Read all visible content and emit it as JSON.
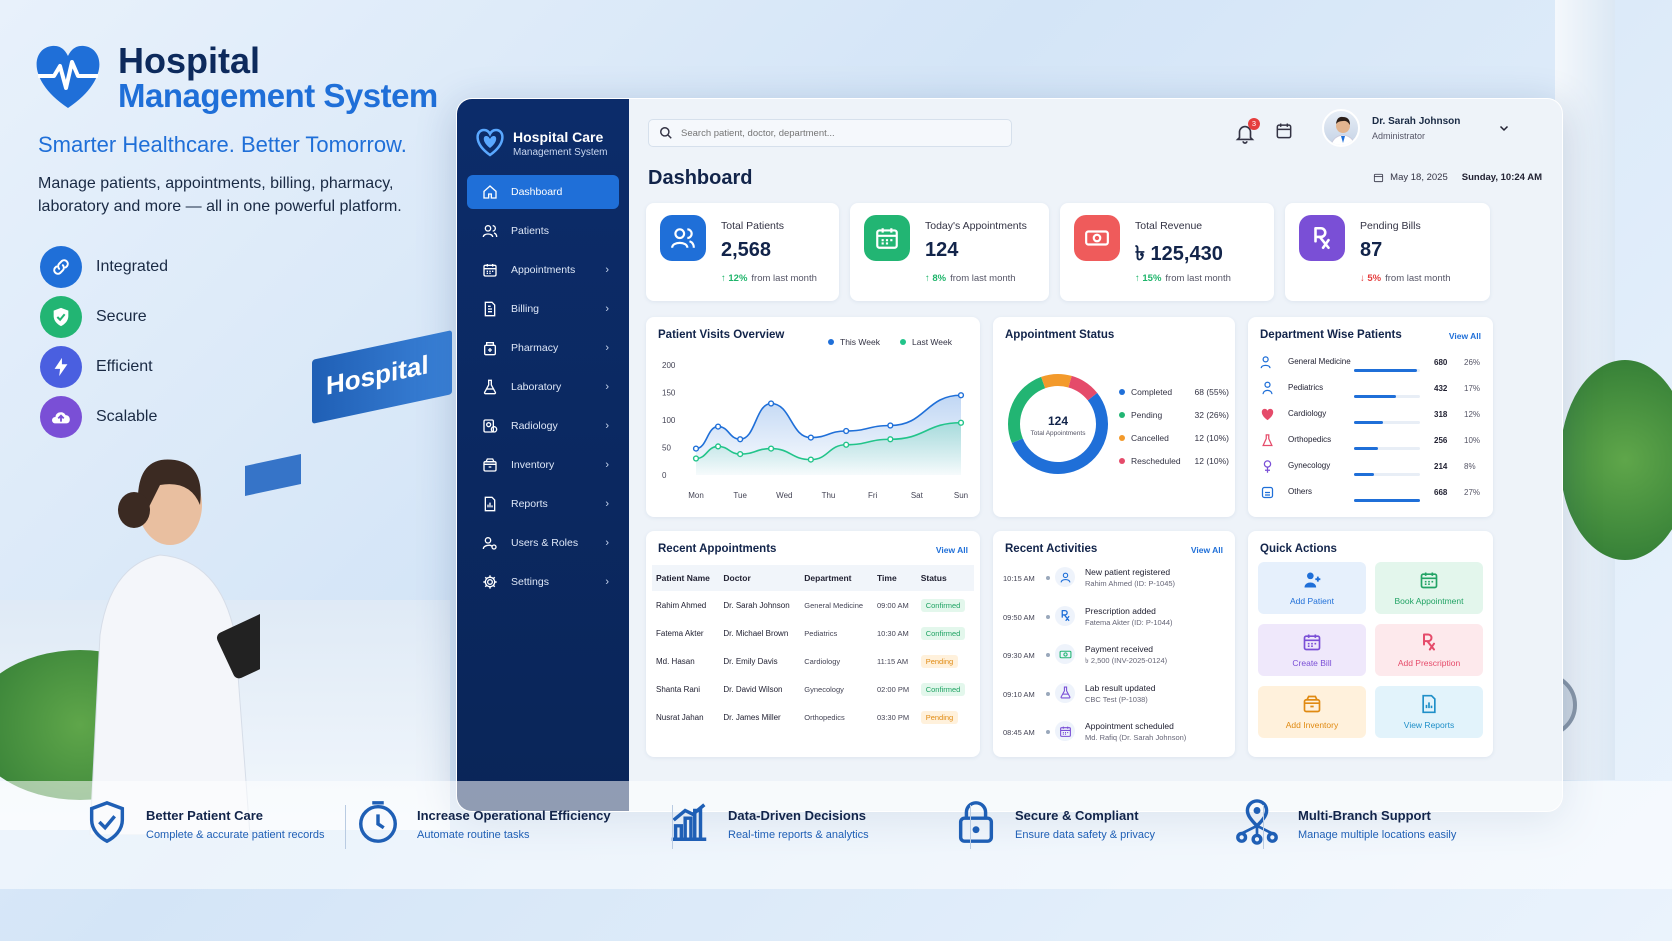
{
  "brand": {
    "title_line1": "Hospital",
    "title_line2": "Management System",
    "tagline": "Smarter Healthcare. Better Tomorrow.",
    "intro": "Manage patients, appointments, billing, pharmacy, laboratory and more — all in one powerful platform."
  },
  "background": {
    "sign_text": "Hospital"
  },
  "features": [
    {
      "label": "Integrated",
      "icon": "link-icon",
      "color": "#1f6fd8"
    },
    {
      "label": "Secure",
      "icon": "shield-check-icon",
      "color": "#22b573"
    },
    {
      "label": "Efficient",
      "icon": "lightning-icon",
      "color": "#4a5fe0"
    },
    {
      "label": "Scalable",
      "icon": "cloud-upload-icon",
      "color": "#7a4fd6"
    }
  ],
  "app": {
    "sidebar_brand": {
      "title": "Hospital Care",
      "subtitle": "Management System"
    },
    "menu": [
      {
        "label": "Dashboard",
        "icon": "home-icon",
        "active": true,
        "chevron": false
      },
      {
        "label": "Patients",
        "icon": "users-icon",
        "chevron": false
      },
      {
        "label": "Appointments",
        "icon": "calendar-icon",
        "chevron": true
      },
      {
        "label": "Billing",
        "icon": "invoice-icon",
        "chevron": true
      },
      {
        "label": "Pharmacy",
        "icon": "pharmacy-icon",
        "chevron": true
      },
      {
        "label": "Laboratory",
        "icon": "flask-icon",
        "chevron": true
      },
      {
        "label": "Radiology",
        "icon": "radiology-icon",
        "chevron": true
      },
      {
        "label": "Inventory",
        "icon": "box-icon",
        "chevron": true
      },
      {
        "label": "Reports",
        "icon": "report-icon",
        "chevron": true
      },
      {
        "label": "Users & Roles",
        "icon": "user-roles-icon",
        "chevron": true
      },
      {
        "label": "Settings",
        "icon": "gear-icon",
        "chevron": true
      }
    ],
    "search_placeholder": "Search patient, doctor, department...",
    "notification_count": "3",
    "user": {
      "name": "Dr. Sarah Johnson",
      "role": "Administrator"
    },
    "page_title": "Dashboard",
    "date": "May 18, 2025",
    "day_time": "Sunday, 10:24 AM",
    "stats": [
      {
        "label": "Total Patients",
        "value": "2,568",
        "change": "↑ 12%",
        "change_text": "from last month",
        "trend": "up",
        "icon": "patients-icon",
        "color": "#1f6fd8"
      },
      {
        "label": "Today's Appointments",
        "value": "124",
        "change": "↑ 8%",
        "change_text": "from last month",
        "trend": "up",
        "icon": "calendar-icon",
        "color": "#22b573"
      },
      {
        "label": "Total Revenue",
        "value": "৳ 125,430",
        "change": "↑ 15%",
        "change_text": "from last month",
        "trend": "up",
        "icon": "cash-icon",
        "color": "#ef5b5b"
      },
      {
        "label": "Pending Bills",
        "value": "87",
        "change": "↓ 5%",
        "change_text": "from last month",
        "trend": "down",
        "icon": "prescription-icon",
        "color": "#7a4fd6"
      }
    ],
    "visits": {
      "title": "Patient Visits Overview",
      "legend": [
        "This Week",
        "Last Week"
      ]
    },
    "appointment_status": {
      "title": "Appointment Status",
      "total": "124",
      "total_label": "Total Appointments",
      "items": [
        {
          "label": "Completed",
          "value": "68 (55%)",
          "color": "#1f6fd8"
        },
        {
          "label": "Pending",
          "value": "32 (26%)",
          "color": "#22b573"
        },
        {
          "label": "Cancelled",
          "value": "12 (10%)",
          "color": "#f39a2b"
        },
        {
          "label": "Rescheduled",
          "value": "12 (10%)",
          "color": "#e54b6a"
        }
      ]
    },
    "departments": {
      "title": "Department Wise Patients",
      "view_all": "View All",
      "items": [
        {
          "name": "General Medicine",
          "count": "680",
          "pct": "26%",
          "share": 0.26,
          "icon": "stethoscope-icon",
          "color": "#1f6fd8"
        },
        {
          "name": "Pediatrics",
          "count": "432",
          "pct": "17%",
          "share": 0.17,
          "icon": "child-icon",
          "color": "#1f6fd8"
        },
        {
          "name": "Cardiology",
          "count": "318",
          "pct": "12%",
          "share": 0.12,
          "icon": "heart-icon",
          "color": "#e54b6a"
        },
        {
          "name": "Orthopedics",
          "count": "256",
          "pct": "10%",
          "share": 0.1,
          "icon": "bone-icon",
          "color": "#e54b6a"
        },
        {
          "name": "Gynecology",
          "count": "214",
          "pct": "8%",
          "share": 0.08,
          "icon": "female-icon",
          "color": "#7a4fd6"
        },
        {
          "name": "Others",
          "count": "668",
          "pct": "27%",
          "share": 0.27,
          "icon": "grid-icon",
          "color": "#1f6fd8"
        }
      ]
    },
    "recent_appointments": {
      "title": "Recent Appointments",
      "view_all": "View All",
      "columns": [
        "Patient Name",
        "Doctor",
        "Department",
        "Time",
        "Status"
      ],
      "rows": [
        {
          "patient": "Rahim Ahmed",
          "doctor": "Dr. Sarah Johnson",
          "department": "General Medicine",
          "time": "09:00 AM",
          "status": "Confirmed"
        },
        {
          "patient": "Fatema Akter",
          "doctor": "Dr. Michael Brown",
          "department": "Pediatrics",
          "time": "10:30 AM",
          "status": "Confirmed"
        },
        {
          "patient": "Md. Hasan",
          "doctor": "Dr. Emily Davis",
          "department": "Cardiology",
          "time": "11:15 AM",
          "status": "Pending"
        },
        {
          "patient": "Shanta Rani",
          "doctor": "Dr. David Wilson",
          "department": "Gynecology",
          "time": "02:00 PM",
          "status": "Confirmed"
        },
        {
          "patient": "Nusrat Jahan",
          "doctor": "Dr. James Miller",
          "department": "Orthopedics",
          "time": "03:30 PM",
          "status": "Pending"
        }
      ]
    },
    "recent_activities": {
      "title": "Recent Activities",
      "view_all": "View All",
      "items": [
        {
          "time": "10:15 AM",
          "title": "New patient registered",
          "detail": "Rahim Ahmed (ID: P-1045)",
          "icon": "user-icon",
          "color": "#1f6fd8"
        },
        {
          "time": "09:50 AM",
          "title": "Prescription added",
          "detail": "Fatema Akter (ID: P-1044)",
          "icon": "prescription-icon",
          "color": "#1f6fd8"
        },
        {
          "time": "09:30 AM",
          "title": "Payment received",
          "detail": "৳ 2,500 (INV-2025-0124)",
          "icon": "cash-icon",
          "color": "#22b573"
        },
        {
          "time": "09:10 AM",
          "title": "Lab result updated",
          "detail": "CBC Test (P-1038)",
          "icon": "flask-icon",
          "color": "#7a4fd6"
        },
        {
          "time": "08:45 AM",
          "title": "Appointment scheduled",
          "detail": "Md. Rafiq (Dr. Sarah Johnson)",
          "icon": "calendar-icon",
          "color": "#7a4fd6"
        }
      ]
    },
    "quick_actions": {
      "title": "Quick Actions",
      "items": [
        {
          "label": "Add Patient",
          "icon": "add-user-icon",
          "color": "#1f6fd8",
          "bg": "#e6f0fc"
        },
        {
          "label": "Book Appointment",
          "icon": "calendar-icon",
          "color": "#22a365",
          "bg": "#e3f6ec"
        },
        {
          "label": "Create Bill",
          "icon": "calendar-icon",
          "color": "#7a4fd6",
          "bg": "#efe8fb"
        },
        {
          "label": "Add Prescription",
          "icon": "prescription-icon",
          "color": "#e54b6a",
          "bg": "#fde9ec"
        },
        {
          "label": "Add Inventory",
          "icon": "box-icon",
          "color": "#e08a12",
          "bg": "#fff1dc"
        },
        {
          "label": "View Reports",
          "icon": "report-icon",
          "color": "#1f8fc8",
          "bg": "#e2f3fb"
        }
      ]
    }
  },
  "chart_data": {
    "type": "line",
    "title": "Patient Visits Overview",
    "categories": [
      "Mon",
      "Tue",
      "Wed",
      "Thu",
      "Fri",
      "Sat",
      "Sun"
    ],
    "ylim": [
      0,
      200
    ],
    "yticks": [
      0,
      50,
      100,
      150,
      200
    ],
    "grid": false,
    "legend_position": "top-right",
    "series": [
      {
        "name": "This Week",
        "color": "#1f6fd8",
        "values": [
          48,
          88,
          65,
          130,
          68,
          80,
          90,
          145
        ]
      },
      {
        "name": "Last Week",
        "color": "#22c48a",
        "values": [
          30,
          52,
          38,
          48,
          28,
          55,
          65,
          95
        ]
      }
    ],
    "x_points": [
      0,
      0.5,
      1,
      1.7,
      2.6,
      3.4,
      4.4,
      6
    ]
  },
  "bottom_features": [
    {
      "title": "Better Patient Care",
      "subtitle": "Complete & accurate patient records",
      "icon": "shield-check-icon"
    },
    {
      "title": "Increase Operational Efficiency",
      "subtitle": "Automate routine tasks",
      "icon": "clock-icon"
    },
    {
      "title": "Data-Driven Decisions",
      "subtitle": "Real-time reports & analytics",
      "icon": "bar-chart-icon"
    },
    {
      "title": "Secure & Compliant",
      "subtitle": "Ensure data safety & privacy",
      "icon": "lock-icon"
    },
    {
      "title": "Multi-Branch Support",
      "subtitle": "Manage multiple locations easily",
      "icon": "location-network-icon"
    }
  ]
}
